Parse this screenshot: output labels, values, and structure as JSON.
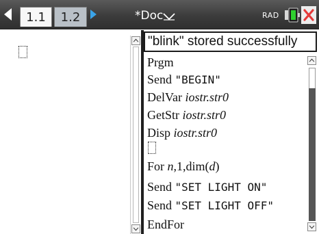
{
  "tabs": [
    {
      "label": "1.1",
      "active": true
    },
    {
      "label": "1.2",
      "active": false
    }
  ],
  "document": {
    "title": "*Doc",
    "angle_mode": "RAD"
  },
  "status_message": "\"blink\" stored successfully",
  "program": {
    "lines": [
      {
        "text": "Prgm"
      },
      {
        "keyword": "Send",
        "string": "\"BEGIN\""
      },
      {
        "keyword": "DelVar",
        "var": "iostr.str0"
      },
      {
        "keyword": "GetStr",
        "var": "iostr.str0"
      },
      {
        "keyword": "Disp",
        "var": "iostr.str0"
      },
      {
        "cursor": true
      },
      {
        "keyword": "For",
        "var": "n",
        "rest": ",1,dim(",
        "arg": "d",
        "close": ")"
      },
      {
        "keyword": "Send",
        "string": "\"SET LIGHT ON\""
      },
      {
        "keyword": "Send",
        "string": "\"SET LIGHT OFF\""
      },
      {
        "text": "EndFor"
      }
    ]
  },
  "icons": {
    "nav_left": "chevron-left-icon",
    "nav_right": "chevron-right-icon",
    "dropdown": "dropdown-icon",
    "battery": "battery-icon",
    "close": "close-icon"
  },
  "colors": {
    "topbar": "#3c3c3c",
    "active_tab": "#f7f7f7",
    "inactive_tab": "#b9c0c7",
    "nav_arrow": "#3aa3e8",
    "battery_green": "#2fd02f",
    "close_red": "#e63a3a"
  }
}
